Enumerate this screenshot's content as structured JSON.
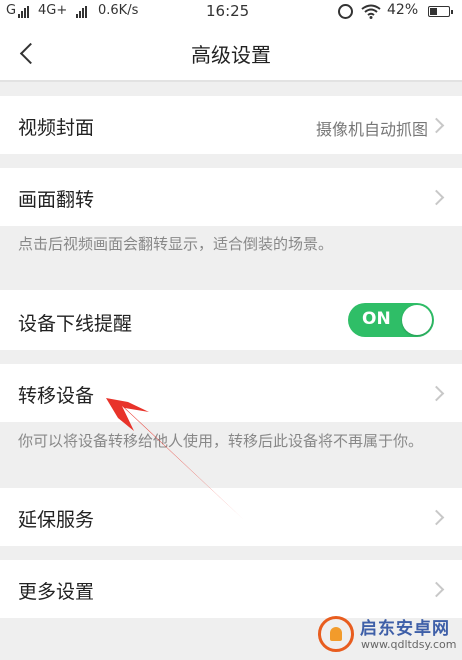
{
  "status_bar": {
    "network_type": "4G+",
    "speed": "0.6K/s",
    "time": "16:25",
    "battery": "42%",
    "battery_level": 0.42
  },
  "header": {
    "title": "高级设置",
    "back_icon": "chevron-left-icon"
  },
  "settings": {
    "cover": {
      "label": "视频封面",
      "value": "摄像机自动抓图"
    },
    "flip": {
      "label": "画面翻转",
      "hint": "点击后视频画面会翻转显示，适合倒装的场景。"
    },
    "offline_alert": {
      "label": "设备下线提醒",
      "toggle_text": "ON",
      "enabled": true
    },
    "transfer": {
      "label": "转移设备",
      "hint": "你可以将设备转移给他人使用，转移后此设备将不再属于你。"
    },
    "warranty": {
      "label": "延保服务"
    },
    "more": {
      "label": "更多设置"
    }
  },
  "colors": {
    "toggle_on": "#2fbe67",
    "annotation_arrow": "#e8332a"
  },
  "watermark": {
    "name": "启东安卓网",
    "url": "www.qdltdsy.com"
  }
}
